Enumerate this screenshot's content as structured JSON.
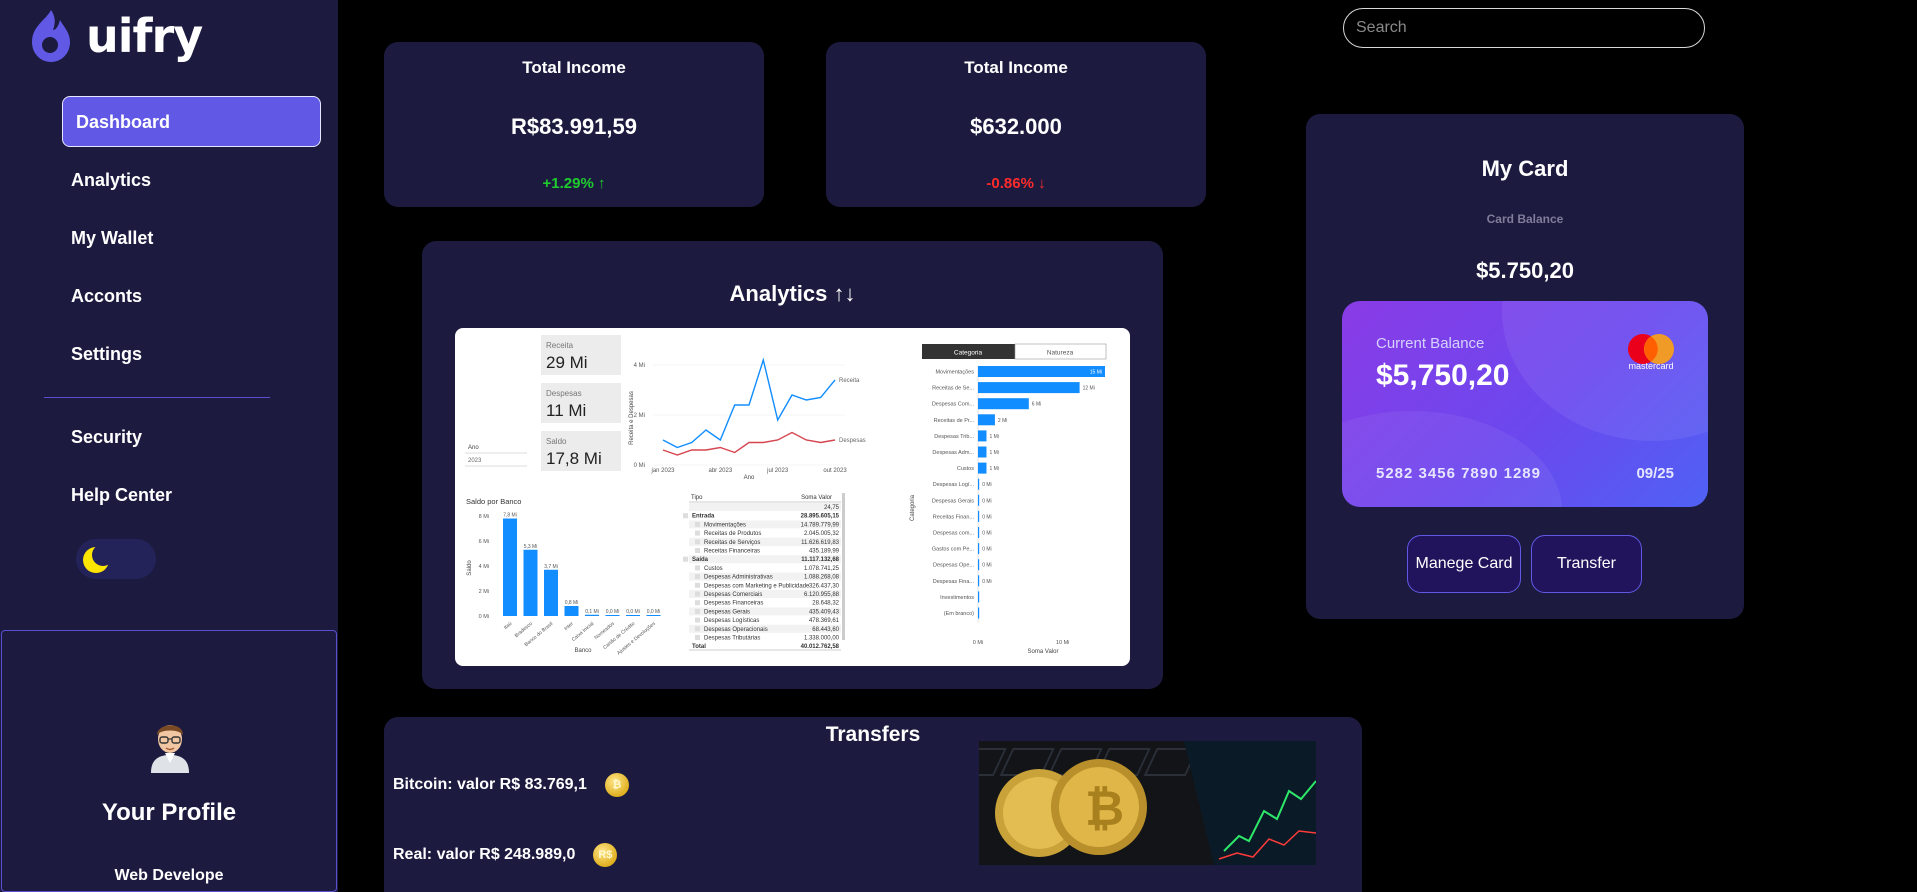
{
  "brand": {
    "name": "uifry",
    "tm": "™",
    "accent": "#6159e6",
    "panel": "#1c1b3f"
  },
  "sidebar": {
    "items": [
      {
        "label": "Dashboard",
        "active": true
      },
      {
        "label": "Analytics"
      },
      {
        "label": "My Wallet"
      },
      {
        "label": "Acconts"
      },
      {
        "label": "Settings"
      }
    ],
    "items2": [
      {
        "label": "Security"
      },
      {
        "label": "Help Center"
      }
    ],
    "theme_toggle_icon": "moon-icon"
  },
  "profile": {
    "title": "Your Profile",
    "role": "Web Develope"
  },
  "search": {
    "placeholder": "Search"
  },
  "income_cards": [
    {
      "title": "Total Income",
      "value": "R$83.991,59",
      "change": "+1.29% ↑",
      "change_color": "#1fcc2e"
    },
    {
      "title": "Total Income",
      "value": "$632.000",
      "change": "-0.86% ↓",
      "change_color": "#ff2b2b"
    }
  ],
  "my_card": {
    "title": "My Card",
    "balance_label": "Card Balance",
    "balance_value": "$5.750,20",
    "card": {
      "label": "Current Balance",
      "value": "$5,750,20",
      "number": "5282 3456 7890 1289",
      "expiry": "09/25",
      "network": "mastercard"
    },
    "buttons": {
      "manage": "Manege Card",
      "transfer": "Transfer"
    }
  },
  "analytics": {
    "title": "Analytics ↑↓",
    "report": {
      "kpis": [
        {
          "label": "Receita",
          "value": "29 Mi"
        },
        {
          "label": "Despesas",
          "value": "11 Mi"
        },
        {
          "label": "Saldo",
          "value": "17,8 Mi"
        }
      ],
      "filters": {
        "ano_label": "Ano",
        "ano_value": "2023"
      },
      "line_chart": {
        "ylabel": "Receita e Despesas",
        "xlabel": "Ano",
        "yticks": [
          "4 Mi",
          "2 Mi",
          "0 Mi"
        ],
        "xticks": [
          "jan 2023",
          "abr 2023",
          "jul 2023",
          "out 2023"
        ],
        "series": [
          {
            "name": "Receita",
            "values": [
              1.0,
              0.7,
              0.9,
              1.4,
              1.0,
              2.4,
              2.4,
              4.2,
              1.8,
              2.8,
              2.6,
              2.7,
              3.4
            ]
          },
          {
            "name": "Despesas",
            "values": [
              0.6,
              0.4,
              0.6,
              0.6,
              0.7,
              0.5,
              0.9,
              0.9,
              1.0,
              1.3,
              1.0,
              0.9,
              1.0
            ]
          }
        ]
      },
      "bank_chart": {
        "title": "Saldo por Banco",
        "ylabel": "Saldo",
        "xlabel": "Banco",
        "yticks": [
          "8 Mi",
          "6 Mi",
          "4 Mi",
          "2 Mi",
          "0 Mi"
        ],
        "categories": [
          "Itaú",
          "Bradesco",
          "Banco do Brasil",
          "Inter",
          "Caixa Inicial",
          "Nomeados",
          "Cartão de Crédito",
          "Ajustes e Devoluções"
        ],
        "values": [
          7.8,
          5.3,
          3.7,
          0.8,
          0.1,
          0.0,
          0.0,
          0.0
        ],
        "labels": [
          "7,8 Mi",
          "5,3 Mi",
          "3,7 Mi",
          "0,8 Mi",
          "0,1 Mi",
          "0,0 Mi",
          "0,0 Mi",
          "0,0 Mi"
        ]
      },
      "table": {
        "headers": [
          "Tipo",
          "Soma Valor"
        ],
        "rows": [
          [
            "",
            "24,75",
            "top"
          ],
          [
            "Entrada",
            "28.895.605,15",
            "group"
          ],
          [
            "Movimentações",
            "14.789.779,99",
            "sub"
          ],
          [
            "Receitas de Produtos",
            "2.045.005,32",
            "sub"
          ],
          [
            "Receitas de Serviços",
            "11.626.619,83",
            "sub"
          ],
          [
            "Receitas Financeiras",
            "435.189,99",
            "sub"
          ],
          [
            "Saída",
            "11.117.132,68",
            "group"
          ],
          [
            "Custos",
            "1.078.741,25",
            "sub"
          ],
          [
            "Despesas Administrativas",
            "1.088.268,08",
            "sub"
          ],
          [
            "Despesas com Marketing e Publicidade",
            "326.437,30",
            "sub"
          ],
          [
            "Despesas Comerciais",
            "6.120.955,88",
            "sub"
          ],
          [
            "Despesas Financeiras",
            "28.648,32",
            "sub"
          ],
          [
            "Despesas Gerais",
            "435.409,43",
            "sub"
          ],
          [
            "Despesas Logísticas",
            "478.369,61",
            "sub"
          ],
          [
            "Despesas Operacionais",
            "68.443,60",
            "sub"
          ],
          [
            "Despesas Tributárias",
            "1.338.000,00",
            "sub"
          ],
          [
            "Total",
            "40.012.762,58",
            "total"
          ]
        ]
      },
      "category_chart": {
        "tabs": [
          "Categoria",
          "Natureza"
        ],
        "ylabel": "Categoria",
        "xlabel": "Soma Valor",
        "xticks": [
          "0 Mi",
          "10 Mi"
        ],
        "categories": [
          "Movimentações",
          "Receitas de Se...",
          "Despesas Com...",
          "Receitas de Pr...",
          "Despesas Trib...",
          "Despesas Adm...",
          "Custos",
          "Despesas Logí...",
          "Despesas Gerais",
          "Receitas Finan...",
          "Despesas com...",
          "Gastos com Pe...",
          "Despesas Ope...",
          "Despesas Fina...",
          "Investimentos",
          "(Em branco)"
        ],
        "values": [
          15,
          12,
          6,
          2,
          1,
          1,
          1,
          0,
          0,
          0,
          0,
          0,
          0,
          0,
          0,
          0
        ],
        "labels": [
          "15 Mi",
          "12 Mi",
          "6 Mi",
          "2 Mi",
          "1 Mi",
          "1 Mi",
          "1 Mi",
          "0 Mi",
          "0 Mi",
          "0 Mi",
          "0 Mi",
          "0 Mi",
          "0 Mi",
          "0 Mi",
          "",
          ""
        ]
      }
    }
  },
  "transfers": {
    "title": "Transfers",
    "items": [
      {
        "label": "Bitcoin: valor R$ 83.769,1",
        "coin": "₿"
      },
      {
        "label": "Real: valor R$ 248.989,0",
        "coin": "R$"
      }
    ]
  }
}
